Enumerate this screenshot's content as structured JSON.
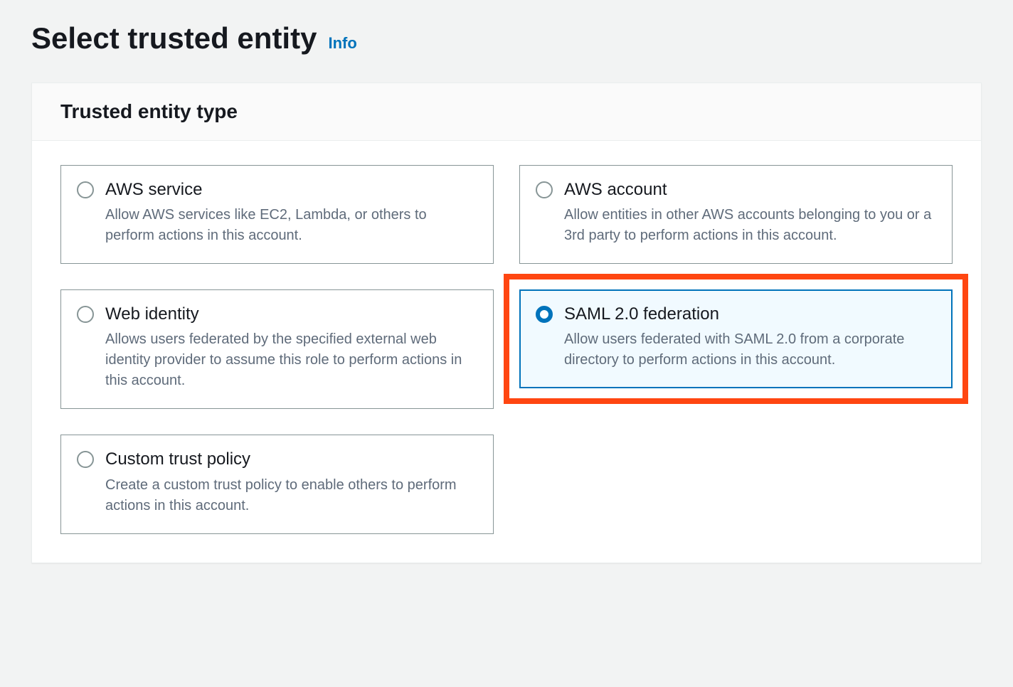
{
  "page": {
    "title": "Select trusted entity",
    "info_link": "Info"
  },
  "panel": {
    "header": "Trusted entity type"
  },
  "options": {
    "aws_service": {
      "title": "AWS service",
      "desc": "Allow AWS services like EC2, Lambda, or others to perform actions in this account."
    },
    "aws_account": {
      "title": "AWS account",
      "desc": "Allow entities in other AWS accounts belonging to you or a 3rd party to perform actions in this account."
    },
    "web_identity": {
      "title": "Web identity",
      "desc": "Allows users federated by the specified external web identity provider to assume this role to perform actions in this account."
    },
    "saml": {
      "title": "SAML 2.0 federation",
      "desc": "Allow users federated with SAML 2.0 from a corporate directory to perform actions in this account."
    },
    "custom": {
      "title": "Custom trust policy",
      "desc": "Create a custom trust policy to enable others to perform actions in this account."
    }
  },
  "selected_option": "saml",
  "highlighted_option": "saml"
}
